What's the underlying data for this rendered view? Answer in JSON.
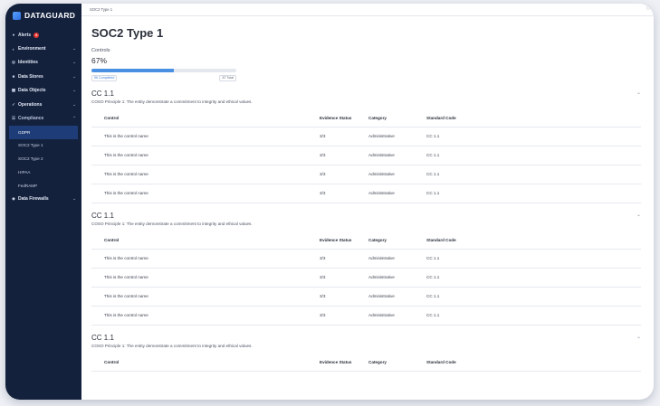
{
  "brand": {
    "name": "DATAGUARD"
  },
  "sidebar": {
    "items": [
      {
        "label": "Alerts",
        "icon": "bell-icon",
        "badge": "6"
      },
      {
        "label": "Environment",
        "icon": "globe-icon"
      },
      {
        "label": "Identities",
        "icon": "identity-icon"
      },
      {
        "label": "Data Stores",
        "icon": "database-icon"
      },
      {
        "label": "Data Objects",
        "icon": "grid-icon"
      },
      {
        "label": "Operations",
        "icon": "check-icon"
      },
      {
        "label": "Compliance",
        "icon": "compliance-icon"
      },
      {
        "label": "Data Firewalls",
        "icon": "shield-icon"
      }
    ],
    "compliance_sub": [
      "GDPR",
      "SOC2 Type 1",
      "SOC2 Type 2",
      "HIPAA",
      "FedRAMP"
    ]
  },
  "breadcrumb": "SOC2 Type 1",
  "page": {
    "title": "SOC2 Type 1",
    "controls_label": "Controls",
    "percent": "67%",
    "progress_fraction": 0.57,
    "completed_label": "56 Completed",
    "total_label": "87 Total"
  },
  "columns": [
    "Control",
    "Evidence Status",
    "Category",
    "Standard Code"
  ],
  "sections": [
    {
      "title": "CC 1.1",
      "description": "COSO Principle 1: The entity demonstrate a commitment to integrity and ethical values.",
      "rows": [
        [
          "This is the control name",
          "3/3",
          "Administrative",
          "CC 1.1"
        ],
        [
          "This is the control name",
          "3/3",
          "Administrative",
          "CC 1.1"
        ],
        [
          "This is the control name",
          "3/3",
          "Administrative",
          "CC 1.1"
        ],
        [
          "This is the control name",
          "3/3",
          "Administrative",
          "CC 1.1"
        ]
      ]
    },
    {
      "title": "CC 1.1",
      "description": "COSO Principle 1: The entity demonstrate a commitment to integrity and ethical values.",
      "rows": [
        [
          "This is the control name",
          "3/3",
          "Administrative",
          "CC 1.1"
        ],
        [
          "This is the control name",
          "3/3",
          "Administrative",
          "CC 1.1"
        ],
        [
          "This is the control name",
          "3/3",
          "Administrative",
          "CC 1.1"
        ],
        [
          "This is the control name",
          "3/3",
          "Administrative",
          "CC 1.1"
        ]
      ]
    },
    {
      "title": "CC 1.1",
      "description": "COSO Principle 1: The entity demonstrate a commitment to integrity and ethical values.",
      "rows": []
    }
  ]
}
